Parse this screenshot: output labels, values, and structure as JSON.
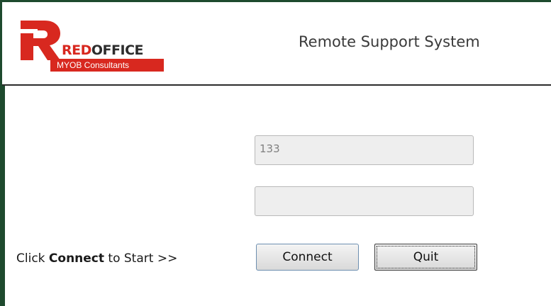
{
  "header": {
    "logo": {
      "brand_red": "RED",
      "brand_dark": "OFFICE",
      "tagline": "MYOB Consultants"
    },
    "app_title": "Remote Support System"
  },
  "form": {
    "field1_value": "133",
    "field2_value": ""
  },
  "footer": {
    "hint_prefix": "Click ",
    "hint_bold": "Connect",
    "hint_suffix": " to Start >>",
    "connect_label": "Connect",
    "quit_label": "Quit"
  },
  "colors": {
    "brand_red": "#d8281f",
    "frame_green": "#1e4a2e"
  }
}
